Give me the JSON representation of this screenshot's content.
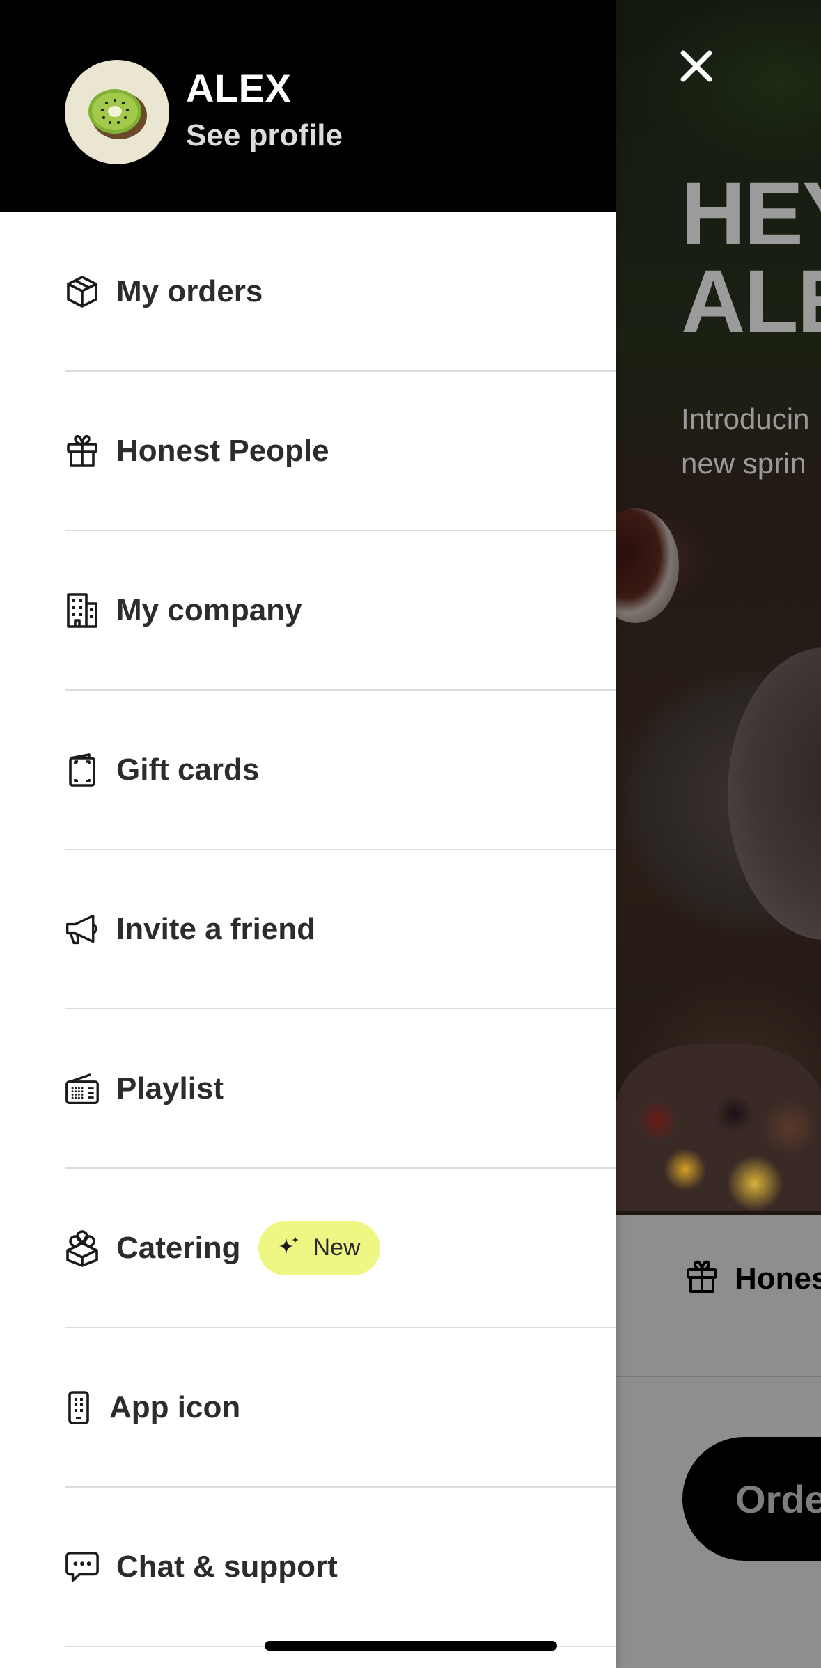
{
  "background": {
    "title": "HEY\nALE",
    "intro": "Introducin\nnew sprin",
    "honest_label": "Hones",
    "order_label": "Orde"
  },
  "drawer": {
    "user": {
      "name": "ALEX",
      "see_profile": "See profile"
    },
    "menu": [
      {
        "label": "My orders",
        "icon": "box-icon"
      },
      {
        "label": "Honest People",
        "icon": "gift-icon"
      },
      {
        "label": "My company",
        "icon": "building-icon"
      },
      {
        "label": "Gift cards",
        "icon": "gift-card-icon"
      },
      {
        "label": "Invite a friend",
        "icon": "megaphone-icon"
      },
      {
        "label": "Playlist",
        "icon": "radio-icon"
      },
      {
        "label": "Catering",
        "icon": "catering-box-icon",
        "badge": "New"
      },
      {
        "label": "App icon",
        "icon": "phone-icon"
      },
      {
        "label": "Chat & support",
        "icon": "chat-icon"
      }
    ]
  },
  "colors": {
    "drawer_header_bg": "#000000",
    "new_badge_bg": "#eef784",
    "text_dark": "#2c2c2c"
  }
}
